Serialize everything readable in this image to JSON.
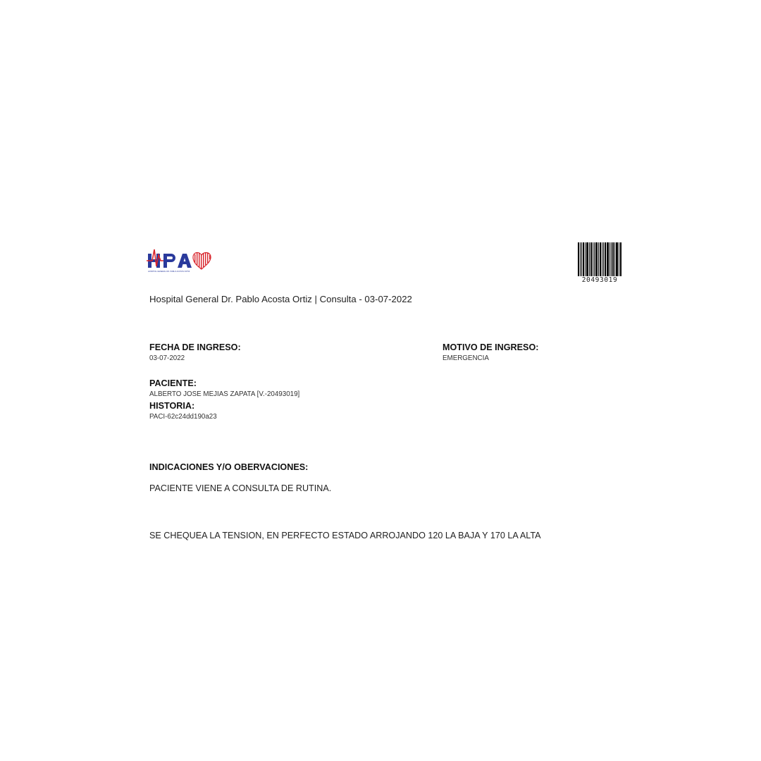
{
  "logo": {
    "text": "HPA",
    "subtext": "HOSPITAL GENERAL DR. PABLO ACOSTA ORTIZ",
    "colors": {
      "letters": "#2a3a9c",
      "heart": "#d8232a"
    }
  },
  "barcode": {
    "number": "20493019"
  },
  "header": {
    "line": "Hospital General Dr. Pablo Acosta Ortiz | Consulta - 03-07-2022"
  },
  "fields": {
    "fecha_label": "FECHA DE INGRESO:",
    "fecha_value": "03-07-2022",
    "motivo_label": "MOTIVO DE INGRESO:",
    "motivo_value": "EMERGENCIA",
    "paciente_label": "PACIENTE:",
    "paciente_value": "ALBERTO JOSE MEJIAS ZAPATA [V.-20493019]",
    "historia_label": "HISTORIA:",
    "historia_value": "PACI-62c24dd190a23"
  },
  "observaciones": {
    "label": "INDICACIONES Y/O OBERVACIONES:",
    "lines": [
      "PACIENTE VIENE A CONSULTA DE RUTINA.",
      "SE CHEQUEA LA TENSION, EN PERFECTO ESTADO ARROJANDO 120 LA BAJA Y 170 LA ALTA"
    ]
  }
}
